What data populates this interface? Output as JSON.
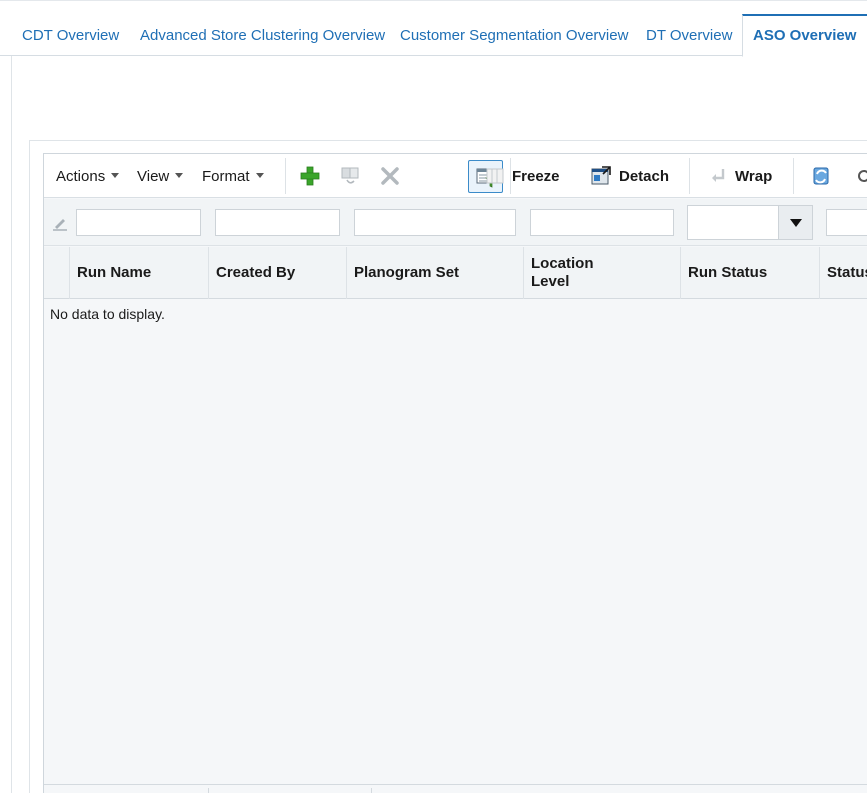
{
  "tabs": [
    {
      "label": "CDT Overview",
      "active": false
    },
    {
      "label": "Advanced Store Clustering Overview",
      "active": false
    },
    {
      "label": "Customer Segmentation Overview",
      "active": false
    },
    {
      "label": "DT Overview",
      "active": false
    },
    {
      "label": "ASO Overview",
      "active": true
    }
  ],
  "toolbar": {
    "actions_label": "Actions",
    "view_label": "View",
    "format_label": "Format",
    "freeze_label": "Freeze",
    "detach_label": "Detach",
    "wrap_label": "Wrap",
    "icons": [
      "add-icon",
      "duplicate-icon",
      "delete-icon",
      "query-by-example-icon",
      "freeze-icon",
      "detach-icon",
      "wrap-icon",
      "refresh-icon"
    ]
  },
  "columns": [
    "Run Name",
    "Created By",
    "Planogram Set",
    "Location Level",
    "Run Status",
    "Status"
  ],
  "table": {
    "empty_message": "No data to display."
  },
  "colors": {
    "accent": "#1f6fb5",
    "add_green": "#3aa52a",
    "toolbar_bg": "#ffffff",
    "grid_bg": "#f5f7f9"
  }
}
